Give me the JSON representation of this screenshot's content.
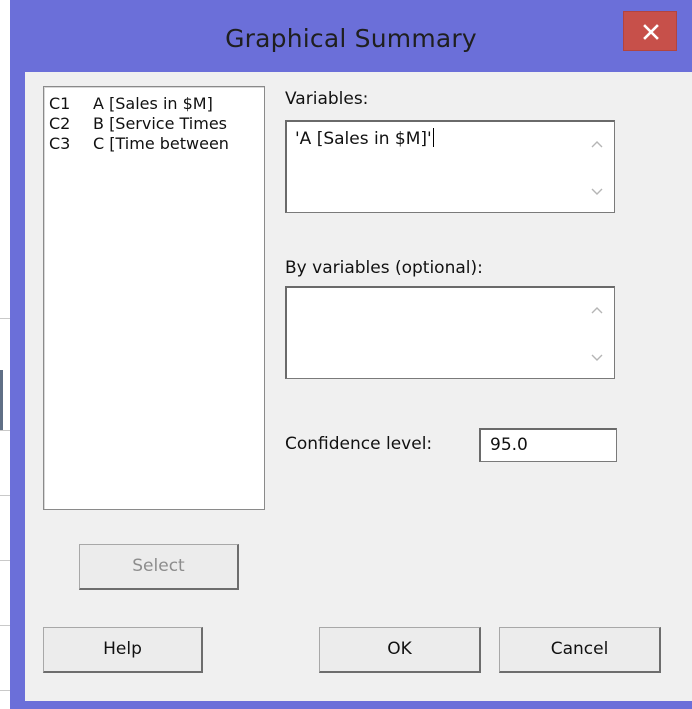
{
  "dialog": {
    "title": "Graphical Summary",
    "close_glyph": "✕"
  },
  "columns_list": {
    "items": [
      {
        "id": "C1",
        "name": "A [Sales in $M]"
      },
      {
        "id": "C2",
        "name": "B [Service Times"
      },
      {
        "id": "C3",
        "name": "C [Time between"
      }
    ]
  },
  "variables": {
    "label": "Variables:",
    "value": "'A [Sales in $M]'"
  },
  "by_variables": {
    "label": "By variables (optional):",
    "value": ""
  },
  "confidence": {
    "label": "Confidence level:",
    "value": "95.0"
  },
  "buttons": {
    "select": "Select",
    "help": "Help",
    "ok": "OK",
    "cancel": "Cancel"
  },
  "colors": {
    "titlebar": "#6b6fd9",
    "close_button": "#c7504a",
    "client_area": "#f0f0f0",
    "disabled_text": "#8d8d8d"
  },
  "icons": {
    "close": "close-icon",
    "scroll_up": "chevron-up-icon",
    "scroll_down": "chevron-down-icon"
  }
}
